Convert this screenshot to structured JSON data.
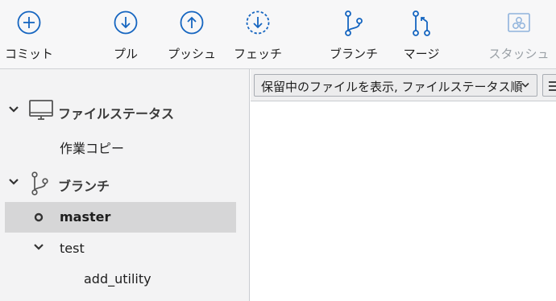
{
  "toolbar": {
    "commit": "コミット",
    "pull": "プル",
    "push": "プッシュ",
    "fetch": "フェッチ",
    "branch": "ブランチ",
    "merge": "マージ",
    "stash": "スタッシュ"
  },
  "sidebar": {
    "file_status": {
      "label": "ファイルステータス",
      "items": [
        "作業コピー"
      ]
    },
    "branches": {
      "label": "ブランチ",
      "master": "master",
      "test_group": "test",
      "test_child": "add_utility"
    }
  },
  "filter": {
    "selected": "保留中のファイルを表示, ファイルステータス順"
  },
  "colors": {
    "accent": "#1565c0",
    "disabled": "#9aa0a6",
    "selected_row": "#d6d6d7"
  }
}
